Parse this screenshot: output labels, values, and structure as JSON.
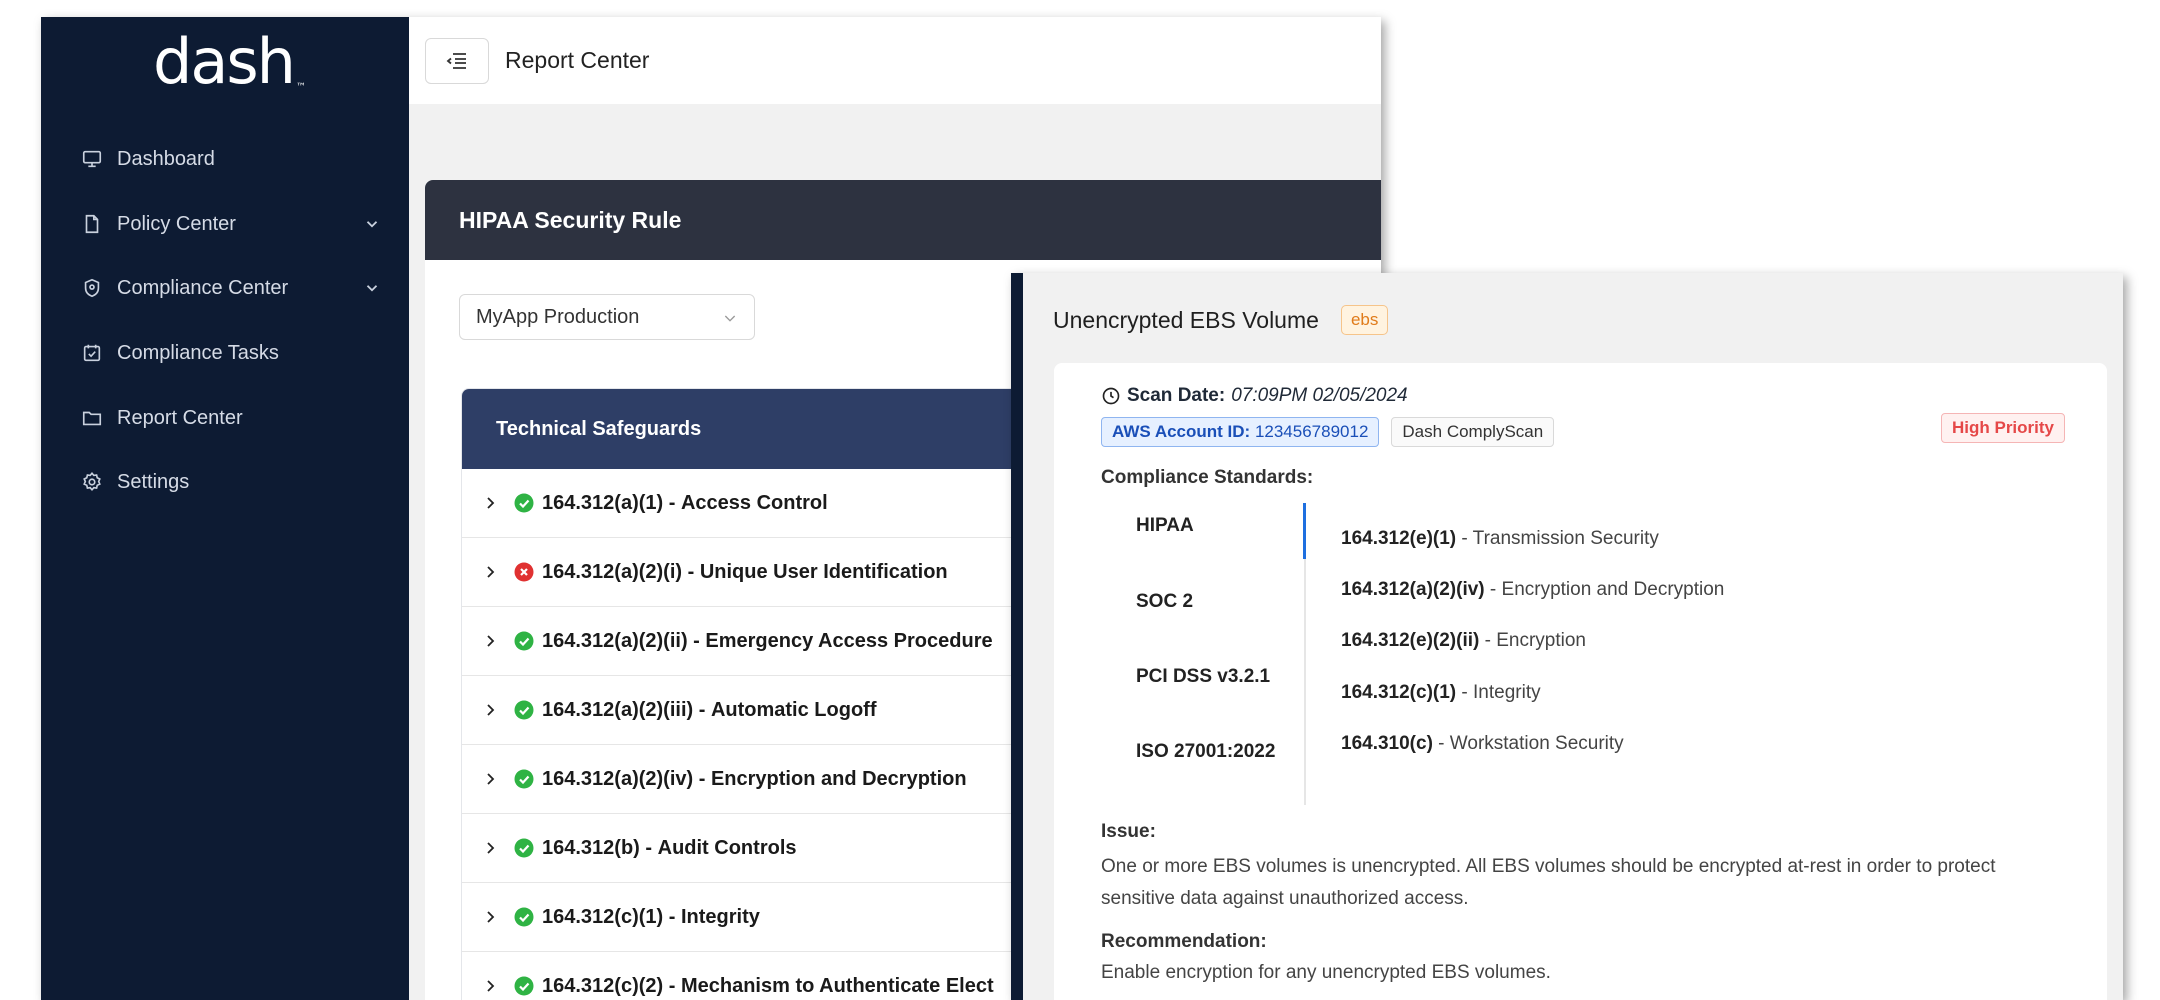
{
  "app": {
    "logo": "dash",
    "logo_tm": "™",
    "sidebar": {
      "items": [
        {
          "label": "Dashboard",
          "icon": "monitor-icon",
          "has_children": false
        },
        {
          "label": "Policy Center",
          "icon": "document-icon",
          "has_children": true
        },
        {
          "label": "Compliance Center",
          "icon": "shield-icon",
          "has_children": true
        },
        {
          "label": "Compliance Tasks",
          "icon": "calendar-check-icon",
          "has_children": false
        },
        {
          "label": "Report Center",
          "icon": "folder-icon",
          "has_children": false
        },
        {
          "label": "Settings",
          "icon": "gear-icon",
          "has_children": false
        }
      ]
    },
    "topbar": {
      "title": "Report Center",
      "menu_icon": "menu-fold-icon"
    },
    "report": {
      "title": "HIPAA Security Rule",
      "environment_select": "MyApp Production",
      "section_title": "Technical Safeguards",
      "rows": [
        {
          "code": "164.312(a)(1)",
          "name": "Access Control",
          "status": "pass"
        },
        {
          "code": "164.312(a)(2)(i)",
          "name": "Unique User Identification",
          "status": "fail"
        },
        {
          "code": "164.312(a)(2)(ii)",
          "name": "Emergency Access Procedure",
          "status": "pass"
        },
        {
          "code": "164.312(a)(2)(iii)",
          "name": "Automatic Logoff",
          "status": "pass"
        },
        {
          "code": "164.312(a)(2)(iv)",
          "name": "Encryption and Decryption",
          "status": "pass"
        },
        {
          "code": "164.312(b)",
          "name": "Audit Controls",
          "status": "pass"
        },
        {
          "code": "164.312(c)(1)",
          "name": "Integrity",
          "status": "pass"
        },
        {
          "code": "164.312(c)(2)",
          "name": "Mechanism to Authenticate Elect",
          "status": "pass"
        }
      ]
    }
  },
  "detail": {
    "title": "Unencrypted EBS Volume",
    "tag": "ebs",
    "scan_date_label": "Scan Date:",
    "scan_date_value": "07:09PM 02/05/2024",
    "aws_label": "AWS Account ID:",
    "aws_value": "123456789012",
    "scanner": "Dash ComplyScan",
    "priority": "High Priority",
    "standards_label": "Compliance Standards:",
    "standards": [
      "HIPAA",
      "SOC 2",
      "PCI DSS v3.2.1",
      "ISO 27001:2022"
    ],
    "requirements": [
      {
        "code": "164.312(e)(1)",
        "name": "Transmission Security"
      },
      {
        "code": "164.312(a)(2)(iv)",
        "name": "Encryption and Decryption"
      },
      {
        "code": "164.312(e)(2)(ii)",
        "name": "Encryption"
      },
      {
        "code": "164.312(c)(1)",
        "name": "Integrity"
      },
      {
        "code": "164.310(c)",
        "name": "Workstation Security"
      }
    ],
    "issue_label": "Issue:",
    "issue_text": "One or more EBS volumes is unencrypted. All EBS volumes should be encrypted at-rest in order to protect sensitive data against unauthorized access.",
    "recommendation_label": "Recommendation:",
    "recommendation_text": "Enable encryption for any unencrypted EBS volumes."
  },
  "colors": {
    "sidebar_bg": "#0d1b33",
    "report_header_bg": "#2d3240",
    "safeguards_header_bg": "#2e3e66",
    "pass": "#2fb344",
    "fail": "#e03131",
    "accent": "#1e6fe0"
  }
}
